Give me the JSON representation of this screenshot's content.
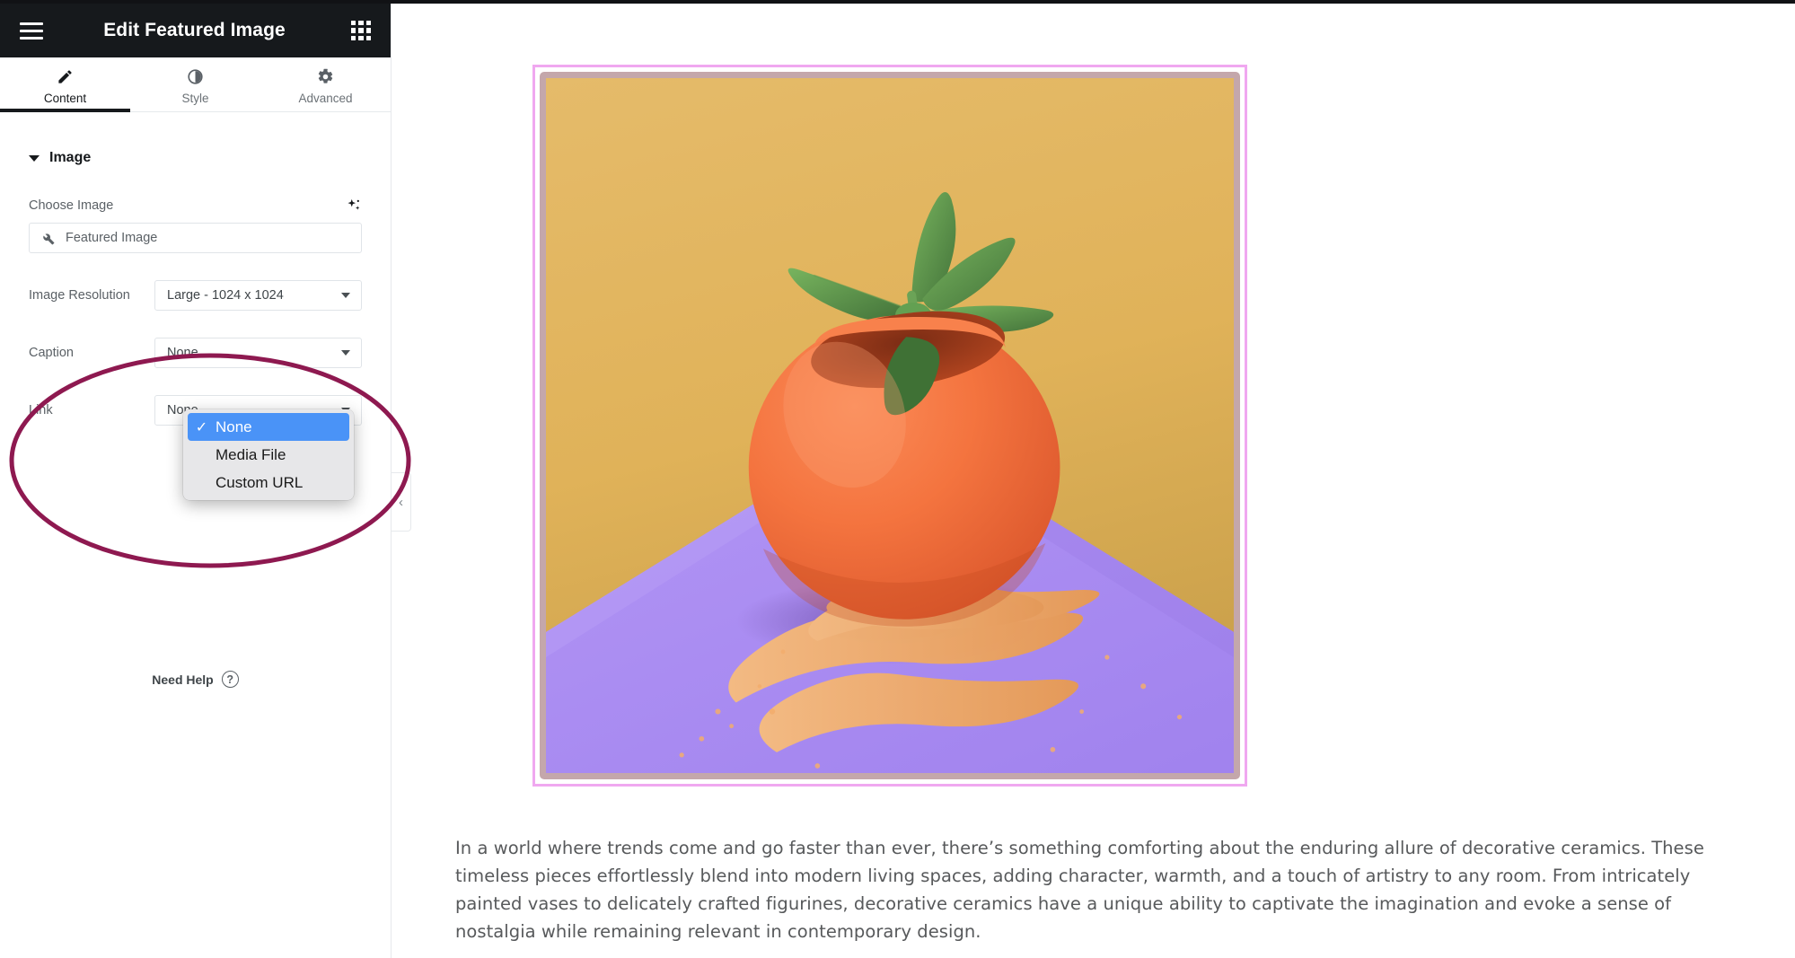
{
  "panel": {
    "header": {
      "title": "Edit Featured Image",
      "menu_icon": "hamburger-icon",
      "apps_icon": "apps-grid-icon"
    },
    "tabs": [
      {
        "label": "Content",
        "icon": "pencil-icon",
        "active": true
      },
      {
        "label": "Style",
        "icon": "contrast-icon",
        "active": false
      },
      {
        "label": "Advanced",
        "icon": "gear-icon",
        "active": false
      }
    ],
    "section": {
      "title": "Image",
      "collapsed": false
    },
    "fields": {
      "choose_image": {
        "label": "Choose Image",
        "ai_icon": "ai-sparkle-icon",
        "value": "Featured Image",
        "dynamic_icon": "wrench-icon"
      },
      "image_resolution": {
        "label": "Image Resolution",
        "value": "Large - 1024 x 1024"
      },
      "caption": {
        "label": "Caption",
        "value": "None"
      },
      "link": {
        "label": "Link",
        "value": "None"
      }
    },
    "link_dropdown": {
      "open": true,
      "options": [
        {
          "label": "None",
          "selected": true
        },
        {
          "label": "Media File",
          "selected": false
        },
        {
          "label": "Custom URL",
          "selected": false
        }
      ],
      "check_glyph": "✓"
    },
    "need_help": {
      "label": "Need Help",
      "icon": "question-circle-icon"
    },
    "collapse_handle": {
      "glyph": "‹",
      "name": "collapse-panel-handle"
    }
  },
  "annotation": {
    "shape": "ellipse",
    "color": "#8E1950",
    "stroke_width": 5
  },
  "canvas": {
    "featured_image": {
      "alt": "Orange spherical ceramic pot with a green jade succulent, on a purple surface with scattered orange sand, against a mustard background",
      "selection_outline_color": "#F0A8F0",
      "frame_color": "#C4A7AB",
      "colors": {
        "background_wall": "#E2B35D",
        "ground": "#AF8FF0",
        "pot": "#F06A3C",
        "plant": "#5E9B4B",
        "sand": "#F2B071"
      }
    },
    "body_text": "In a world where trends come and go faster than ever, there’s something comforting about the enduring allure of decorative ceramics. These timeless pieces effortlessly blend into modern living spaces, adding character, warmth, and a touch of artistry to any room. From intricately painted vases to delicately crafted figurines, decorative ceramics have a unique ability to captivate the imagination and evoke a sense of nostalgia while remaining relevant in contemporary design."
  }
}
